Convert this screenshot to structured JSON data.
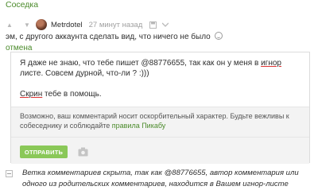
{
  "topline": {
    "text": "Соседка"
  },
  "comment": {
    "author": "Metrdotel",
    "time": "27 минут назад",
    "text": "эм, с другого аккаунта сделать вид, что ничего не было",
    "cancel_label": "отмена"
  },
  "reply": {
    "line1_before": "Я даже не знаю, что тебе пишет  @88776655, так как он у меня в ",
    "line1_underlined": "игнор",
    "line1_after": " листе. Совсем дурной, что-ли ? :)))",
    "line2_underlined": "Скрин",
    "line2_after": " тебе в помощь.",
    "warning_text": "Возможно, ваш комментарий носит оскорбительный характер. Будьте вежливы к собеседнику и соблюдайте ",
    "warning_link": "правила Пикабу",
    "send_label": "ОТПРАВИТЬ"
  },
  "collapsed": {
    "text": "Ветка комментариев скрыта, так как @88776655, автор комментария или одного из родительских комментариев, находится в Вашем игнор-листе"
  },
  "colors": {
    "accent": "#4a8a2a",
    "button": "#8ac858",
    "underline": "#dd3333"
  },
  "icons": [
    "vote-up-icon",
    "vote-down-icon",
    "avatar",
    "save-icon",
    "more-icon",
    "smile-icon",
    "camera-icon",
    "collapse-icon"
  ]
}
